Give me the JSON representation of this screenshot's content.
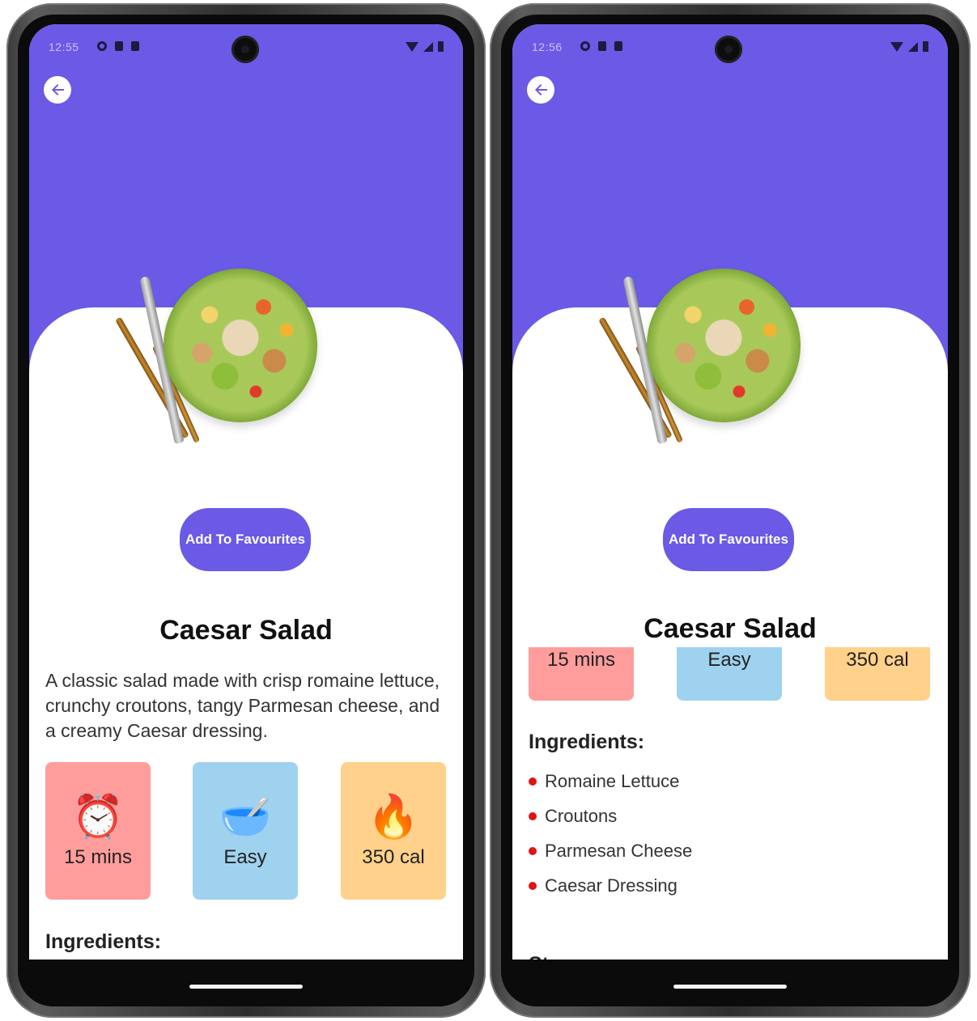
{
  "screens": [
    {
      "status_time": "12:55",
      "fav_label": "Add To Favourites",
      "title": "Caesar Salad",
      "description": "A classic salad made with crisp romaine lettuce, crunchy croutons, tangy Parmesan cheese, and a creamy Caesar dressing.",
      "cards": [
        "15 mins",
        "Easy",
        "350 cal"
      ],
      "ingredients_heading": "Ingredients:"
    },
    {
      "status_time": "12:56",
      "fav_label": "Add To Favourites",
      "title": "Caesar Salad",
      "cards": [
        "15 mins",
        "Easy",
        "350 cal"
      ],
      "ingredients_heading": "Ingredients:",
      "ingredients": [
        "Romaine Lettuce",
        "Croutons",
        "Parmesan Cheese",
        "Caesar Dressing"
      ],
      "steps_heading": "Steps:"
    }
  ],
  "icons": {
    "time": "alarm-clock-icon",
    "difficulty": "bowl-icon",
    "calories": "fire-icon",
    "back": "back-arrow-icon"
  },
  "colors": {
    "accent": "#6a5ae6",
    "time_card": "#ff9d9d",
    "difficulty_card": "#9fd2ef",
    "calories_card": "#ffd18a",
    "bullet": "#e01313"
  }
}
